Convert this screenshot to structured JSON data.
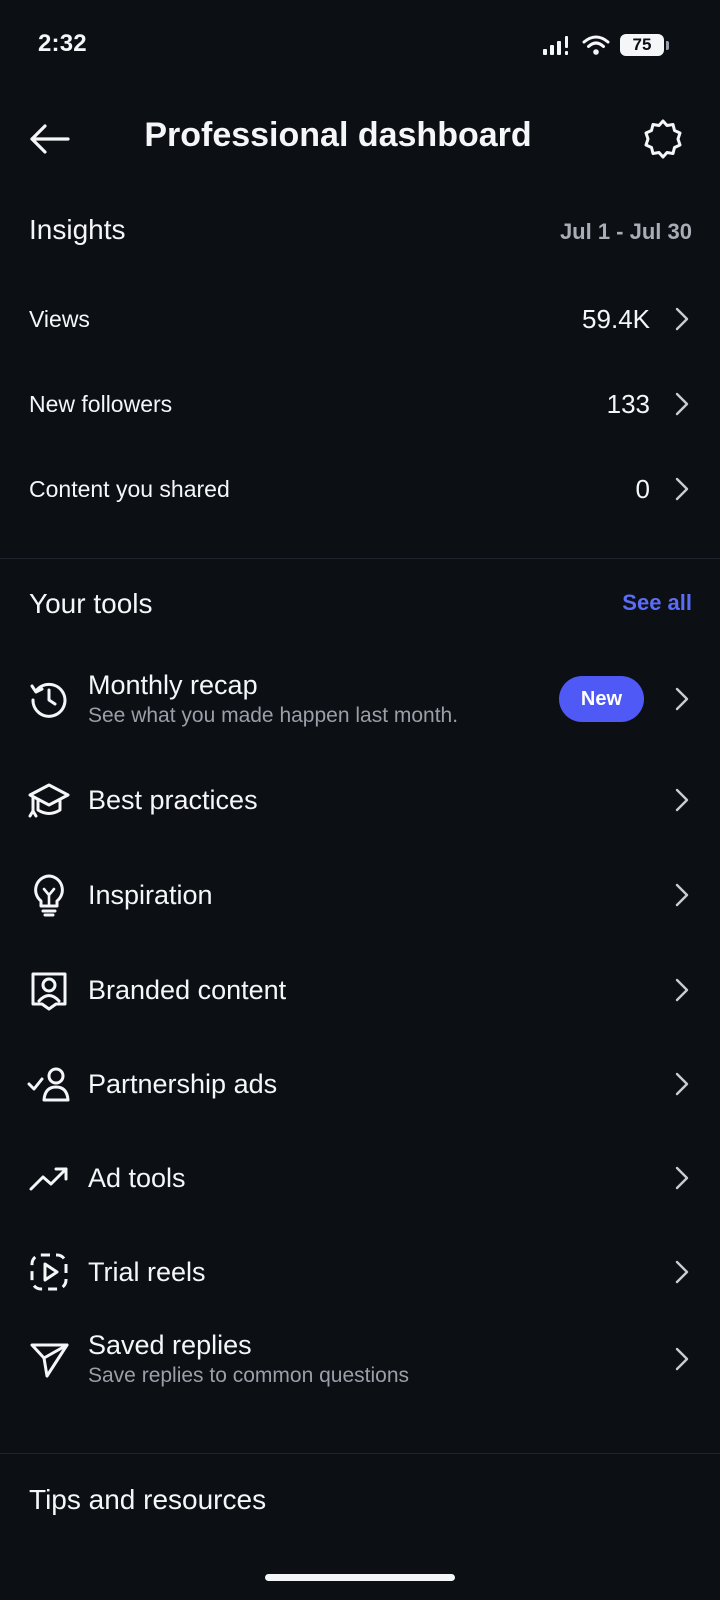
{
  "status_bar": {
    "time": "2:32",
    "battery": "75"
  },
  "header": {
    "title": "Professional dashboard"
  },
  "insights": {
    "title": "Insights",
    "date_range": "Jul 1 - Jul 30",
    "rows": [
      {
        "label": "Views",
        "value": "59.4K"
      },
      {
        "label": "New followers",
        "value": "133"
      },
      {
        "label": "Content you shared",
        "value": "0"
      }
    ]
  },
  "tools": {
    "title": "Your tools",
    "see_all": "See all",
    "items": [
      {
        "label": "Monthly recap",
        "subtitle": "See what you made happen last month.",
        "badge": "New",
        "icon": "history-icon"
      },
      {
        "label": "Best practices",
        "icon": "graduation-cap-icon"
      },
      {
        "label": "Inspiration",
        "icon": "lightbulb-icon"
      },
      {
        "label": "Branded content",
        "icon": "branded-content-icon"
      },
      {
        "label": "Partnership ads",
        "icon": "partnership-icon"
      },
      {
        "label": "Ad tools",
        "icon": "trending-up-icon"
      },
      {
        "label": "Trial reels",
        "icon": "trial-reels-icon"
      },
      {
        "label": "Saved replies",
        "subtitle": "Save replies to common questions",
        "icon": "send-icon"
      }
    ]
  },
  "tips": {
    "title": "Tips and resources"
  },
  "colors": {
    "background": "#0c0f14",
    "accent": "#4f5af6",
    "link": "#5b6cf9"
  }
}
